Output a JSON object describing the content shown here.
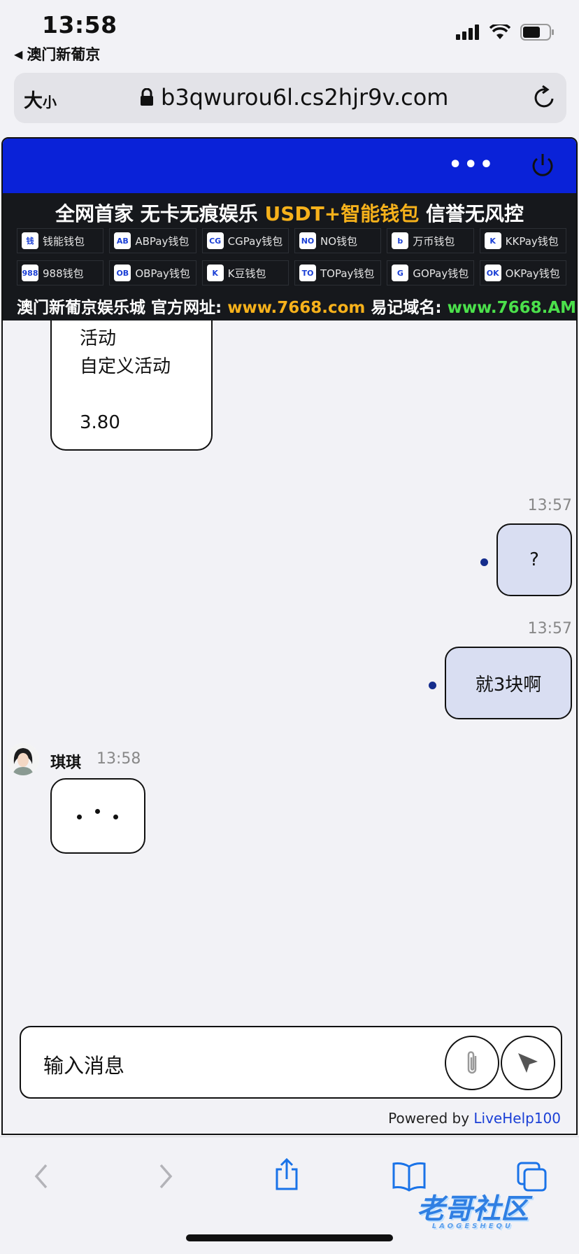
{
  "status_bar": {
    "time": "13:58",
    "back_app": "澳门新葡京"
  },
  "url_bar": {
    "text_size_label_big": "大",
    "text_size_label_small": "小",
    "url": "b3qwurou6l.cs2hjr9v.com"
  },
  "banner": {
    "title_part1": "全网首家 无卡无痕娱乐 ",
    "title_highlight": "USDT+智能钱包",
    "title_part2": " 信誉无风控",
    "wallets": [
      {
        "label": "钱能钱包",
        "icon": "钱"
      },
      {
        "label": "ABPay钱包",
        "icon": "AB"
      },
      {
        "label": "CGPay钱包",
        "icon": "CG"
      },
      {
        "label": "NO钱包",
        "icon": "NO"
      },
      {
        "label": "万币钱包",
        "icon": "b"
      },
      {
        "label": "KKPay钱包",
        "icon": "K"
      },
      {
        "label": "988钱包",
        "icon": "988"
      },
      {
        "label": "OBPay钱包",
        "icon": "OB"
      },
      {
        "label": "K豆钱包",
        "icon": "K"
      },
      {
        "label": "TOPay钱包",
        "icon": "TO"
      },
      {
        "label": "GOPay钱包",
        "icon": "G"
      },
      {
        "label": "OKPay钱包",
        "icon": "OK"
      }
    ],
    "footer_label1": "澳门新葡京娱乐城 官方网址: ",
    "footer_url1": "www.7668.com",
    "footer_label2": " 易记域名: ",
    "footer_url2": "www.7668.AM"
  },
  "chat": {
    "card_line1": "活动",
    "card_line2": "自定义活动",
    "card_line3": "3.80",
    "msg1_time": "13:57",
    "msg1_text": "?",
    "msg2_time": "13:57",
    "msg2_text": "就3块啊",
    "agent_name": "琪琪",
    "agent_time": "13:58"
  },
  "composer": {
    "placeholder": "输入消息",
    "powered_by": "Powered by ",
    "powered_link": "LiveHelp100"
  },
  "watermark": {
    "text": "老哥社区",
    "sub": "LAOGESHEQU"
  },
  "colors": {
    "topbar": "#0a22d8",
    "banner_bg": "#16181c",
    "highlight_yellow": "#f6b11b",
    "highlight_green": "#4be04b",
    "user_bubble": "#d9def2",
    "link": "#1a3fd6"
  }
}
